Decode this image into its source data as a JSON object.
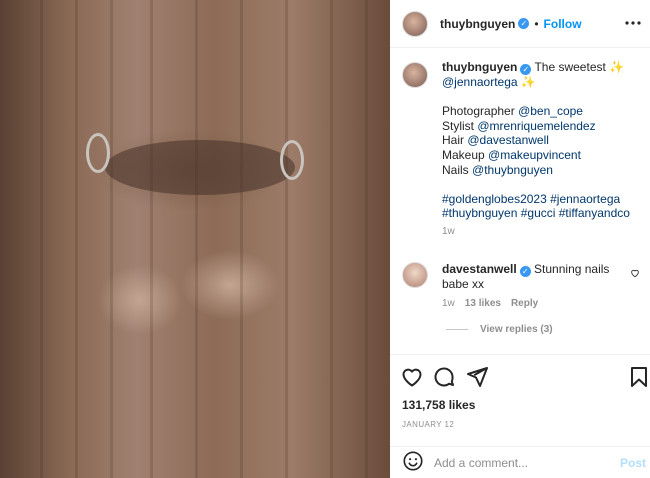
{
  "post": {
    "author": "thuybnguyen",
    "follow_label": "Follow",
    "separator": "•"
  },
  "caption": {
    "author": "thuybnguyen",
    "line1": "The sweetest ✨",
    "line2_mention": "@jennaortega",
    "line2_suffix": " ✨",
    "credits": [
      {
        "role": "Photographer",
        "handle": "@ben_cope"
      },
      {
        "role": "Stylist",
        "handle": "@mrenriquemelendez"
      },
      {
        "role": "Hair",
        "handle": "@davestanwell"
      },
      {
        "role": "Makeup",
        "handle": "@makeupvincent"
      },
      {
        "role": "Nails",
        "handle": "@thuybnguyen"
      }
    ],
    "hashtags_line1": "#goldenglobes2023 #jennaortega",
    "hashtags_line2": "#thuybnguyen #gucci #tiffanyandco",
    "time": "1w"
  },
  "comment": {
    "author": "davestanwell",
    "text_line1": "Stunning nails",
    "text_line2": "babe xx",
    "time": "1w",
    "likes": "13 likes",
    "reply": "Reply",
    "view_replies": "View replies (3)"
  },
  "actions": {
    "icons": [
      "heart-icon",
      "comment-icon",
      "share-icon",
      "bookmark-icon"
    ],
    "likes": "131,758 likes",
    "date": "JANUARY 12"
  },
  "add_comment": {
    "placeholder": "Add a comment...",
    "post_label": "Post"
  },
  "colors": {
    "link": "#00376b",
    "follow": "#0095f6",
    "verified": "#3897f0",
    "muted": "#8e8e8e",
    "post_disabled": "#b2dffc"
  }
}
